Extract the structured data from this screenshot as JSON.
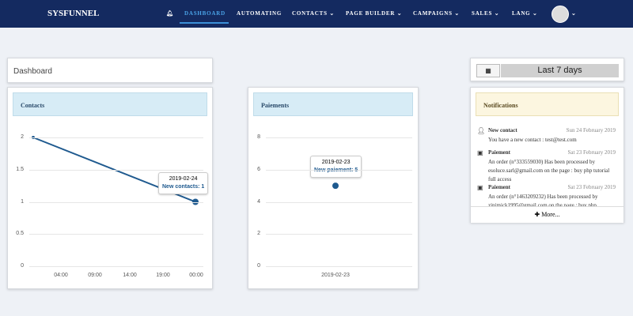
{
  "nav": {
    "brand": "SYSFUNNEL",
    "items": [
      "DASHBOARD",
      "AUTOMATING",
      "CONTACTS ⌄",
      "PAGE BUILDER ⌄",
      "CAMPAIGNS ⌄",
      "SALES ⌄",
      "LANG ⌄"
    ],
    "avatar_caret": "⌄"
  },
  "dashboard": {
    "title": "Dashboard"
  },
  "contacts_chart": {
    "title": "Contacts",
    "tooltip_date": "2019-02-24",
    "tooltip_value": "New contacts: 1"
  },
  "paiement_chart": {
    "title": "Paiements",
    "tooltip_date": "2019-02-23",
    "tooltip_value": "New paiement: 5"
  },
  "date_range": {
    "label": "Last 7 days"
  },
  "notifications": {
    "title": "Notifications",
    "items": [
      {
        "type": "New contact",
        "date": "Sun 24 February 2019",
        "body": "You have a new contact : test@test.com"
      },
      {
        "type": "Paiement",
        "date": "Sat 23 February 2019",
        "body": "An order (n°333559030) Has been processed by esoluce.sarl@gmail.com on the page : buy php tutorial full access"
      },
      {
        "type": "Paiement",
        "date": "Sat 23 February 2019",
        "body": "An order (n°1463209232) Has been processed by zinimick1995@gmail.com on the page : buy php"
      }
    ],
    "more": "✚ More..."
  },
  "chart_data": [
    {
      "type": "line",
      "title": "Contacts",
      "x": [
        "04:00",
        "09:00",
        "14:00",
        "19:00",
        "00:00"
      ],
      "yticks": [
        "0",
        "0.5",
        "1",
        "1.5",
        "2"
      ],
      "ylim": [
        0,
        2
      ],
      "series": [
        {
          "name": "New contacts",
          "points": [
            [
              0,
              2
            ],
            [
              1,
              1
            ]
          ]
        }
      ]
    },
    {
      "type": "line",
      "title": "Paiements",
      "x": [
        "2019-02-23"
      ],
      "yticks": [
        "0",
        "2",
        "4",
        "6",
        "8"
      ],
      "ylim": [
        0,
        8
      ],
      "series": [
        {
          "name": "New paiement",
          "values": [
            5
          ]
        }
      ]
    }
  ]
}
